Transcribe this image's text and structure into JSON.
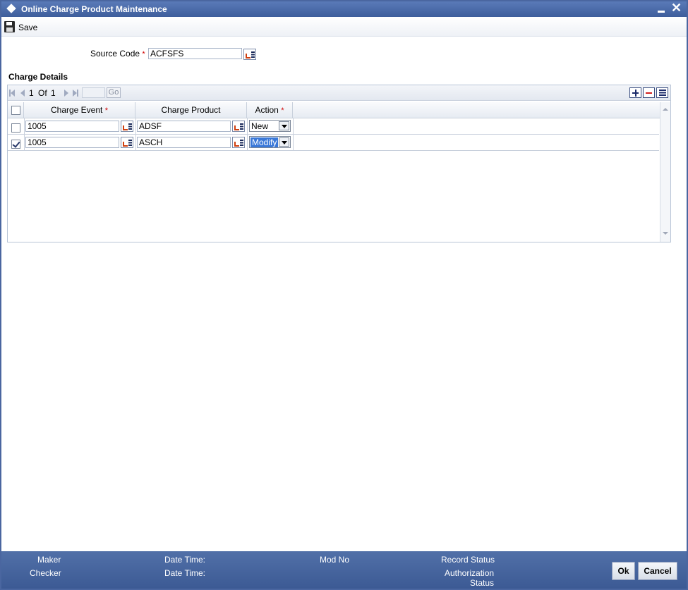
{
  "window": {
    "title": "Online Charge Product Maintenance"
  },
  "toolbar": {
    "save_label": "Save"
  },
  "form": {
    "source_code_label": "Source Code",
    "required_mark": "*",
    "source_code_value": "ACFSFS"
  },
  "charge_details": {
    "section_title": "Charge Details",
    "pager": {
      "current": "1",
      "of_label": "Of",
      "total": "1",
      "go_label": "Go"
    },
    "columns": [
      "Charge Event",
      "Charge Product",
      "Action"
    ],
    "rows": [
      {
        "checked": false,
        "charge_event": "1005",
        "charge_product": "ADSF",
        "action": "New"
      },
      {
        "checked": true,
        "charge_event": "1005",
        "charge_product": "ASCH",
        "action": "Modify"
      }
    ]
  },
  "footer": {
    "maker_label": "Maker",
    "checker_label": "Checker",
    "date_time_label_1": "Date Time:",
    "date_time_label_2": "Date Time:",
    "mod_no_label": "Mod No",
    "record_status_label": "Record Status",
    "authorization_label": "Authorization",
    "status_label": "Status",
    "ok_label": "Ok",
    "cancel_label": "Cancel"
  },
  "icons": [
    "diamond-icon",
    "minimize-icon",
    "close-icon",
    "save-icon",
    "lov-icon",
    "first-page-icon",
    "prev-page-icon",
    "next-page-icon",
    "last-page-icon",
    "add-row-icon",
    "delete-row-icon",
    "single-view-icon",
    "dropdown-icon"
  ]
}
